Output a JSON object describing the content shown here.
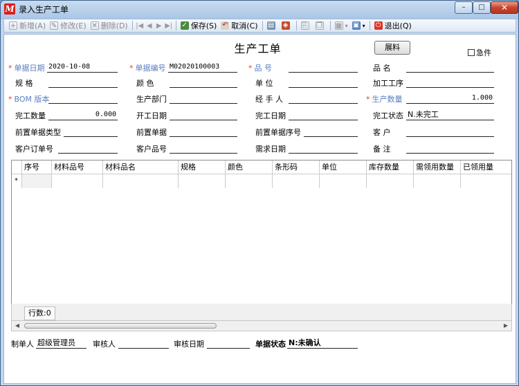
{
  "window": {
    "title": "录入生产工单",
    "app_icon_letter": "M",
    "controls": [
      "–",
      "□",
      "✕"
    ]
  },
  "toolbar": {
    "new": "新增(A)",
    "edit": "修改(E)",
    "delete": "删除(D)",
    "save": "保存(S)",
    "cancel": "取消(C)",
    "exit": "退出(Q)",
    "nav": [
      "|◀",
      "◀",
      "▶",
      "▶|"
    ]
  },
  "form": {
    "title": "生产工单",
    "material_button": "展料",
    "urgent_label": "急件",
    "doc_date_label": "单据日期",
    "doc_date": "2020-10-08",
    "doc_no_label": "单据编号",
    "doc_no": "M02020100003",
    "item_no_label": "品    号",
    "item_no": "",
    "item_name_label": "品    名",
    "item_name": "",
    "spec_label": "规    格",
    "spec": "",
    "color_label": "颜    色",
    "color": "",
    "unit_label": "单    位",
    "unit": "",
    "process_label": "加工工序",
    "process": "",
    "bom_label": "BOM 版本",
    "bom": "",
    "dept_label": "生产部门",
    "dept": "",
    "handler_label": "经 手 人",
    "handler": "",
    "qty_label": "生产数量",
    "qty": "1.000",
    "done_qty_label": "完工数量",
    "done_qty": "0.000",
    "start_date_label": "开工日期",
    "start_date": "",
    "finish_date_label": "完工日期",
    "finish_date": "",
    "finish_status_label": "完工状态",
    "finish_status": "N.未完工",
    "prev_type_label": "前置单据类型",
    "prev_type": "",
    "prev_doc_label": "前置单据",
    "prev_doc": "",
    "prev_seq_label": "前置单据序号",
    "prev_seq": "",
    "customer_label": "客    户",
    "customer": "",
    "cust_order_label": "客户订单号",
    "cust_order": "",
    "cust_item_label": "客户品号",
    "cust_item": "",
    "req_date_label": "需求日期",
    "req_date": "",
    "remark_label": "备    注",
    "remark": ""
  },
  "grid": {
    "columns": [
      "序号",
      "材料品号",
      "材料品名",
      "规格",
      "颜色",
      "条形码",
      "单位",
      "库存数量",
      "需领用数量",
      "已领用量"
    ],
    "new_row_marker": "*",
    "row_count": "行数:0"
  },
  "footer": {
    "creator_label": "制单人",
    "creator": "超级管理员",
    "reviewer_label": "审核人",
    "reviewer": "",
    "review_date_label": "审核日期",
    "review_date": "",
    "status_label": "单据状态",
    "status": "N:未确认"
  }
}
